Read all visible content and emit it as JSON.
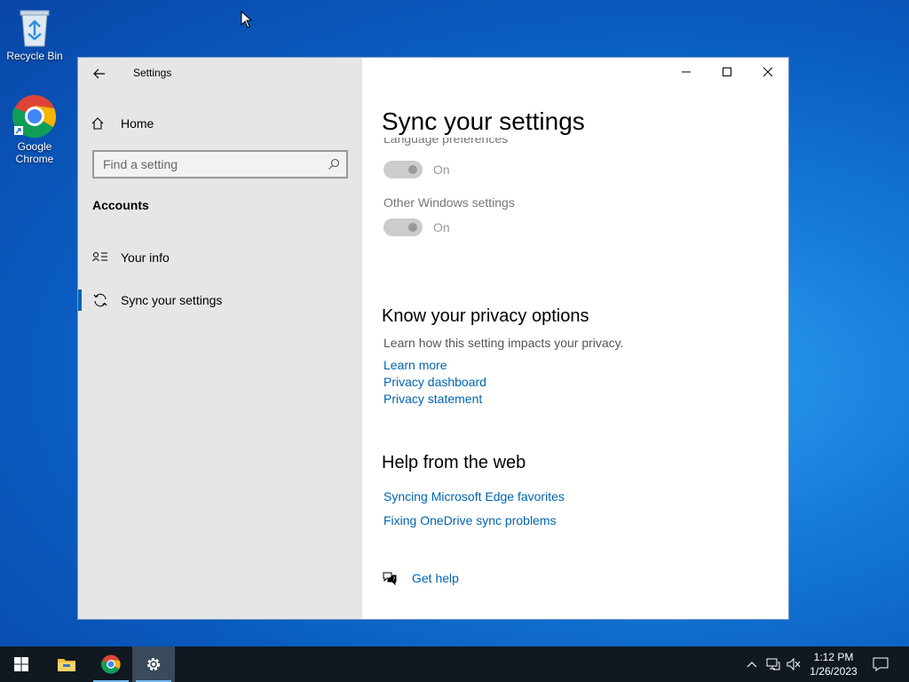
{
  "desktop": {
    "icons": [
      {
        "label": "Recycle Bin"
      },
      {
        "label": "Google Chrome"
      }
    ]
  },
  "window": {
    "app_title": "Settings",
    "controls": {
      "minimize": "minimize-icon",
      "maximize": "maximize-icon",
      "close": "close-icon"
    }
  },
  "sidebar": {
    "home_label": "Home",
    "search_placeholder": "Find a setting",
    "section_title": "Accounts",
    "items": [
      {
        "label": "Your info",
        "icon": "contact-info-icon",
        "active": false
      },
      {
        "label": "Sync your settings",
        "icon": "sync-icon",
        "active": true
      }
    ]
  },
  "main": {
    "page_title": "Sync your settings",
    "settings": [
      {
        "label": "Language preferences",
        "state": "On",
        "disabled": true
      },
      {
        "label": "Other Windows settings",
        "state": "On",
        "disabled": true
      }
    ],
    "privacy": {
      "heading": "Know your privacy options",
      "description": "Learn how this setting impacts your privacy.",
      "links": [
        "Learn more",
        "Privacy dashboard",
        "Privacy statement"
      ]
    },
    "help_web": {
      "heading": "Help from the web",
      "links": [
        "Syncing Microsoft Edge favorites",
        "Fixing OneDrive sync problems"
      ]
    },
    "get_help": "Get help"
  },
  "taskbar": {
    "clock_time": "1:12 PM",
    "clock_date": "1/26/2023"
  },
  "colors": {
    "accent": "#0063b1",
    "sidebar_bg": "#e6e6e6",
    "taskbar_bg": "#101820"
  }
}
